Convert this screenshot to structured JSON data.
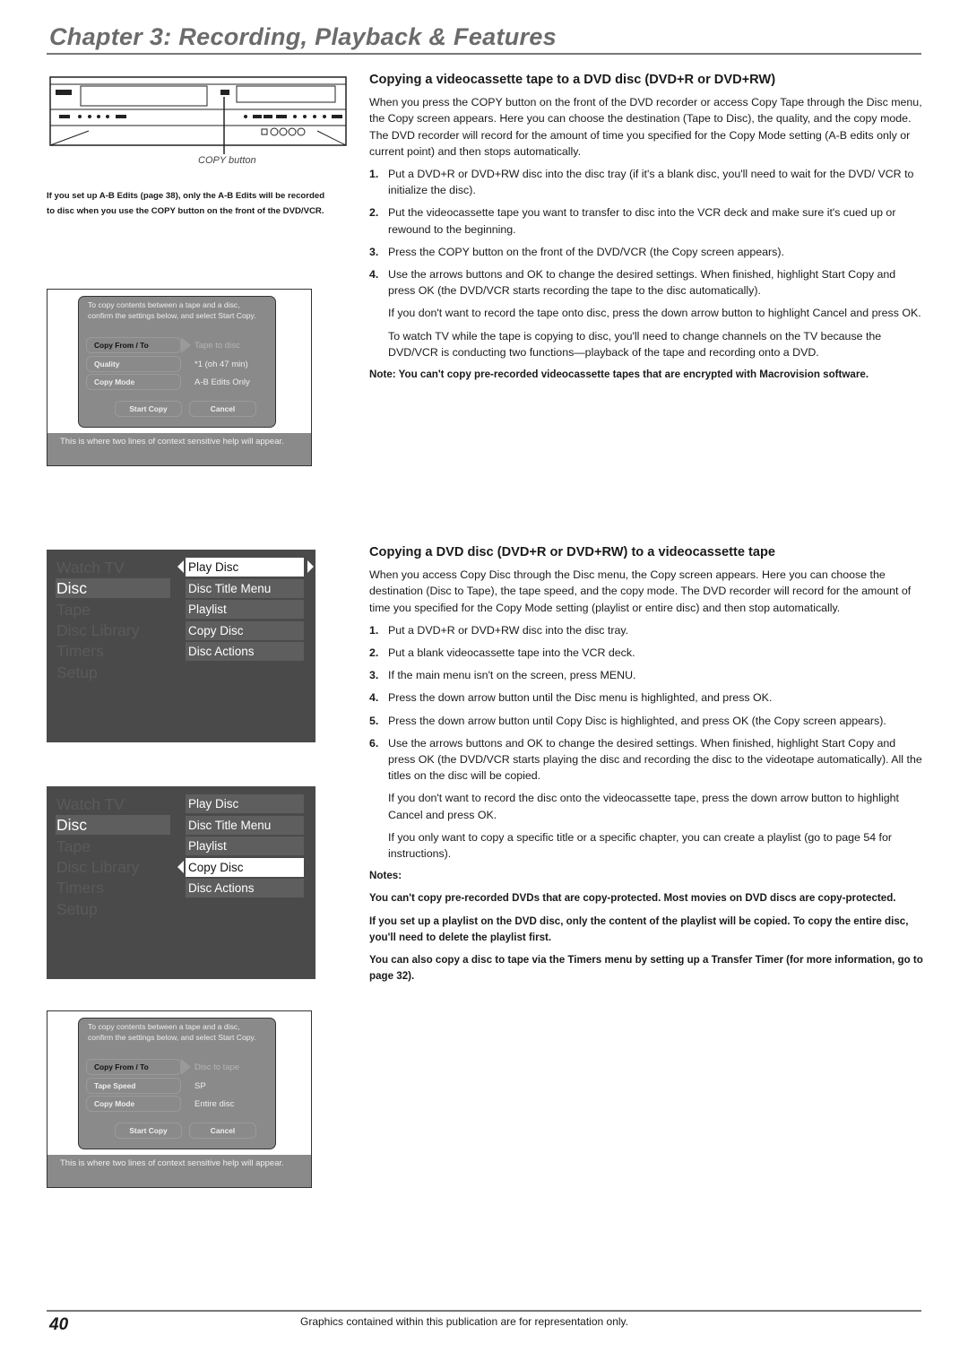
{
  "header": {
    "chapter_title": "Chapter 3: Recording, Playback & Features"
  },
  "left": {
    "device_caption": "COPY button",
    "device_note": "If you set up A-B Edits (page 38), only the A-B Edits will be recorded to disc when you use the COPY button on the front of the DVD/VCR.",
    "screen1": {
      "intro": "To copy contents between a tape and a disc, confirm the settings below, and select Start Copy.",
      "rows": [
        {
          "label": "Copy From / To",
          "value": "Tape to disc"
        },
        {
          "label": "Quality",
          "value": "*1 (oh 47 min)"
        },
        {
          "label": "Copy Mode",
          "value": "A-B Edits Only"
        }
      ],
      "start_label": "Start Copy",
      "cancel_label": "Cancel",
      "help": "This is where two lines of context sensitive help will appear."
    },
    "menu1": {
      "main_items": [
        "Watch TV",
        "Disc",
        "Tape",
        "Disc Library",
        "Timers",
        "Setup"
      ],
      "active_main": "Disc",
      "sub_items": [
        "Play Disc",
        "Disc Title Menu",
        "Playlist",
        "Copy Disc",
        "Disc Actions"
      ],
      "selected_sub": "Play Disc"
    },
    "menu2": {
      "main_items": [
        "Watch TV",
        "Disc",
        "Tape",
        "Disc Library",
        "Timers",
        "Setup"
      ],
      "active_main": "Disc",
      "sub_items": [
        "Play Disc",
        "Disc Title Menu",
        "Playlist",
        "Copy Disc",
        "Disc Actions"
      ],
      "selected_sub": "Copy Disc"
    },
    "screen2": {
      "intro": "To copy contents between a tape and a disc, confirm the settings below, and select Start Copy.",
      "rows": [
        {
          "label": "Copy From / To",
          "value": "Disc to tape"
        },
        {
          "label": "Tape Speed",
          "value": "SP"
        },
        {
          "label": "Copy Mode",
          "value": "Entire disc"
        }
      ],
      "start_label": "Start Copy",
      "cancel_label": "Cancel",
      "help": "This is where two lines of context sensitive help will appear."
    }
  },
  "section1": {
    "heading": "Copying a videocassette tape to a DVD disc (DVD+R or DVD+RW)",
    "intro": "When you press the COPY button on the front of the DVD recorder or access Copy Tape through the Disc menu, the Copy screen appears. Here you can choose the destination (Tape to Disc), the quality, and the copy mode. The DVD recorder will record for the amount of time you specified for the Copy Mode setting (A-B edits only or current point) and then stops automatically.",
    "steps": [
      {
        "n": "1.",
        "text": "Put a DVD+R or DVD+RW disc into the disc tray (if it's a blank disc, you'll need to wait for the DVD/ VCR to initialize the disc)."
      },
      {
        "n": "2.",
        "text": "Put the videocassette tape you want to transfer to disc into the VCR deck and make sure it's cued up or rewound to the beginning."
      },
      {
        "n": "3.",
        "text": "Press the COPY button on the front of the DVD/VCR (the Copy screen appears)."
      },
      {
        "n": "4.",
        "text": "Use the arrows buttons and OK to change the desired settings. When finished, highlight Start Copy and press OK (the DVD/VCR starts recording the tape to the disc automatically)."
      }
    ],
    "after": [
      "If you don't want to record the tape onto disc, press the down arrow button to highlight Cancel and press OK.",
      "To watch TV while the tape is copying to disc, you'll need to change channels on the TV because the DVD/VCR is conducting two functions—playback of the tape and recording onto a DVD."
    ],
    "note": "Note: You can't copy pre-recorded videocassette tapes that are encrypted with Macrovision software."
  },
  "section2": {
    "heading": "Copying a DVD disc (DVD+R or DVD+RW) to a videocassette tape",
    "intro": "When you access Copy Disc through the Disc menu, the Copy screen appears. Here you can choose the destination (Disc to Tape), the tape speed, and the copy mode. The DVD recorder will record for the amount of time you specified for the Copy Mode setting (playlist or entire disc) and then stop automatically.",
    "steps": [
      {
        "n": "1.",
        "text": "Put a DVD+R or DVD+RW disc into the disc tray."
      },
      {
        "n": "2.",
        "text": "Put a blank videocassette tape into the VCR deck."
      },
      {
        "n": "3.",
        "text": "If the main menu isn't on the screen, press MENU."
      },
      {
        "n": "4.",
        "text": "Press the down arrow button until the Disc menu is highlighted, and press OK."
      },
      {
        "n": "5.",
        "text": "Press the down arrow button until Copy Disc is highlighted, and press OK (the Copy screen appears)."
      },
      {
        "n": "6.",
        "text": "Use the arrows buttons and OK to change the desired settings. When finished, highlight Start Copy and press OK (the DVD/VCR starts playing the disc and recording the disc to the videotape automatically). All the titles on the disc will be copied."
      }
    ],
    "after": [
      "If you don't want to record the disc onto the videocassette tape, press the down arrow button to highlight Cancel and press OK.",
      "If you only want to copy a specific title or a specific chapter, you can create a playlist (go to page 54 for instructions)."
    ],
    "notes_heading": "Notes:",
    "notes": [
      "You can't copy pre-recorded DVDs that are copy-protected. Most movies on DVD discs are copy-protected.",
      "If you set up a playlist on the DVD disc, only the content of the playlist will be copied. To copy the entire disc, you'll need to delete the playlist first.",
      "You can also copy a disc to tape via the Timers menu by setting up a Transfer Timer (for more information, go to page 32)."
    ]
  },
  "footer": {
    "page_number": "40",
    "text": "Graphics contained within this publication are for representation only."
  }
}
